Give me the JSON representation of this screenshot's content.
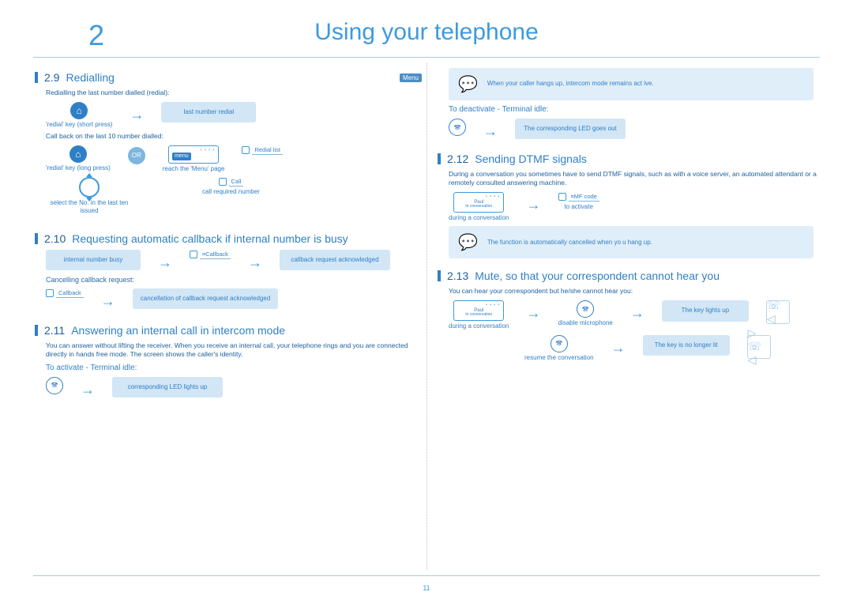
{
  "chapter": {
    "number": "2",
    "title": "Using your telephone"
  },
  "page_number": "11",
  "left": {
    "s29": {
      "num": "2.9",
      "title": "Redialling",
      "menu_tag": "Menu",
      "intro": "Redialling the last number dialled (redial):",
      "step1_caption": "'redial' key (short press)",
      "step1_stub": "last number redial",
      "sub2": "Call back on the last 10 number dialled:",
      "r2_c1": "'redial' key (long press)",
      "r2_or": "OR",
      "r2_c2_btn": "menu",
      "r2_c2_caption": "reach the 'Menu' page",
      "r2_c3_sk": "Redial list",
      "r3_c1": "select the No. in the last ten issued",
      "r3_c2_sk": "Call",
      "r3_c2_caption": "call required number"
    },
    "s210": {
      "num": "2.10",
      "title": "Requesting automatic callback if internal number is busy",
      "stub1": "internal number busy",
      "sk": "¤Callback",
      "stub2": "callback request acknowledged",
      "sub": "Cancelling callback request:",
      "sk2": "Callback",
      "stub3": "cancellation of callback request acknowledged"
    },
    "s211": {
      "num": "2.11",
      "title": "Answering an internal call in intercom mode",
      "body": "You can answer without lifting the receiver. When you receive an internal call, your telephone rings and you are connected directly in hands free mode. The screen shows the caller's identity.",
      "activate": "To activate - Terminal idle:",
      "stub": "corresponding LED lights up"
    }
  },
  "right": {
    "hint1": "When your caller hangs up, intercom mode remains act   ive.",
    "deactivate": "To deactivate - Terminal idle:",
    "stub_deact": "The corresponding LED goes out",
    "s212": {
      "num": "2.12",
      "title": "Sending DTMF signals",
      "body": "During a conversation you sometimes have to send DTMF signals, such as with a voice server, an automated attendant or a remotely consulted answering machine.",
      "screen_name": "Paul",
      "screen_state": "In conversation",
      "c1_caption": "during a conversation",
      "sk": "¤MF code",
      "c2_caption": "to activate",
      "hint": "The function is automatically cancelled when yo   u hang up."
    },
    "s213": {
      "num": "2.13",
      "title": "Mute, so that your correspondent cannot hear you",
      "body": "You can hear your correspondent but he/she cannot hear you:",
      "screen_name": "Paul",
      "screen_state": "In conversation",
      "c1_caption": "during a conversation",
      "c2_caption": "disable microphone",
      "stub1": "The key lights up",
      "r2_caption": "resume the conversation",
      "stub2": "The key is no longer lit"
    }
  }
}
